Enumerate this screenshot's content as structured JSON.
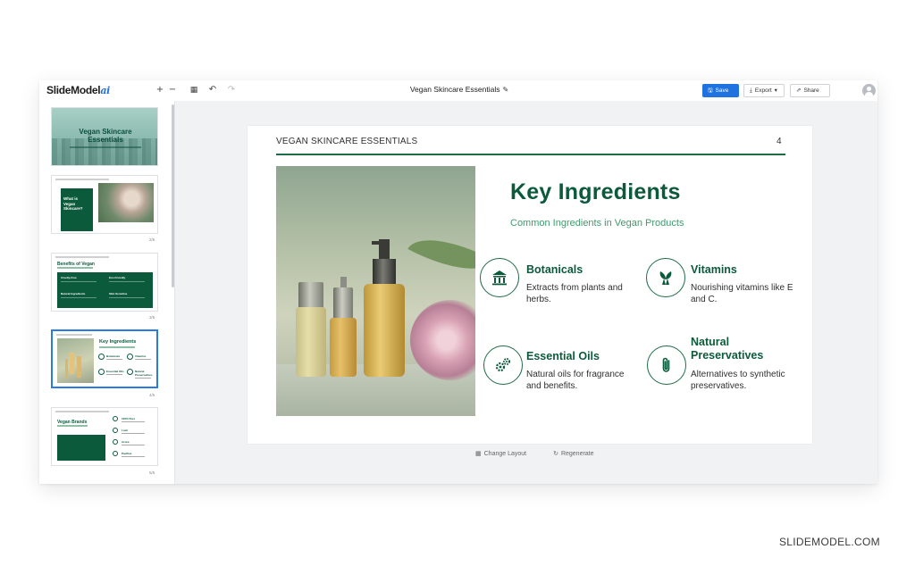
{
  "app": {
    "logo_text": "SlideModel",
    "logo_suffix": "ai",
    "doc_title": "Vegan Skincare Essentials",
    "buttons": {
      "save": "Save",
      "export": "Export",
      "share": "Share"
    },
    "icons": {
      "add": "+",
      "remove": "−",
      "layout": "▦",
      "undo": "↶",
      "redo": "↷",
      "edit": "✎",
      "save_icon": "🖫",
      "export_icon": "⤓",
      "dropdown": "▾",
      "share_icon": "⇗"
    }
  },
  "sidebar": {
    "thumbnails": [
      {
        "title": "Vegan Skincare Essentials",
        "num": ""
      },
      {
        "title": "What is Vegan Skincare?",
        "num": "2/5"
      },
      {
        "title": "Benefits of Vegan",
        "cells": [
          "Cruelty-Free",
          "Eco-Friendly",
          "Natural Ingredients",
          "Skin Sensitive"
        ],
        "num": "3/5"
      },
      {
        "title": "Key Ingredients",
        "labels": [
          "Botanicals",
          "Vitamins",
          "Essential Oils",
          "Natural Preservatives"
        ],
        "num": "4/5"
      },
      {
        "title": "Vegan Brands",
        "labels": [
          "100% Pure",
          "Lush",
          "Acure",
          "Pacifica"
        ],
        "num": "5/5"
      }
    ]
  },
  "slide": {
    "header": "VEGAN SKINCARE ESSENTIALS",
    "page_number": "4",
    "title": "Key Ingredients",
    "subtitle": "Common Ingredients in Vegan Products",
    "features": [
      {
        "icon": "building-columns-icon",
        "title": "Botanicals",
        "desc_line1": "Extracts from plants and",
        "desc_line2": "herbs."
      },
      {
        "icon": "plant-icon",
        "title": "Vitamins",
        "desc_line1": "Nourishing vitamins like E",
        "desc_line2": "and C."
      },
      {
        "icon": "gears-icon",
        "title": "Essential Oils",
        "desc_line1": "Natural oils for fragrance",
        "desc_line2": "and benefits."
      },
      {
        "icon": "paperclip-icon",
        "title_line1": "Natural",
        "title_line2": "Preservatives",
        "desc_line1": "Alternatives to synthetic",
        "desc_line2": "preservatives."
      }
    ]
  },
  "canvas_actions": {
    "change_layout": "Change Layout",
    "regenerate": "Regenerate",
    "change_layout_icon": "▦",
    "regenerate_icon": "↻"
  },
  "watermark": "SLIDEMODEL.COM",
  "colors": {
    "brand_green": "#0c5a3c",
    "accent_green": "#3f9a6e",
    "primary_blue": "#1f73e0"
  }
}
